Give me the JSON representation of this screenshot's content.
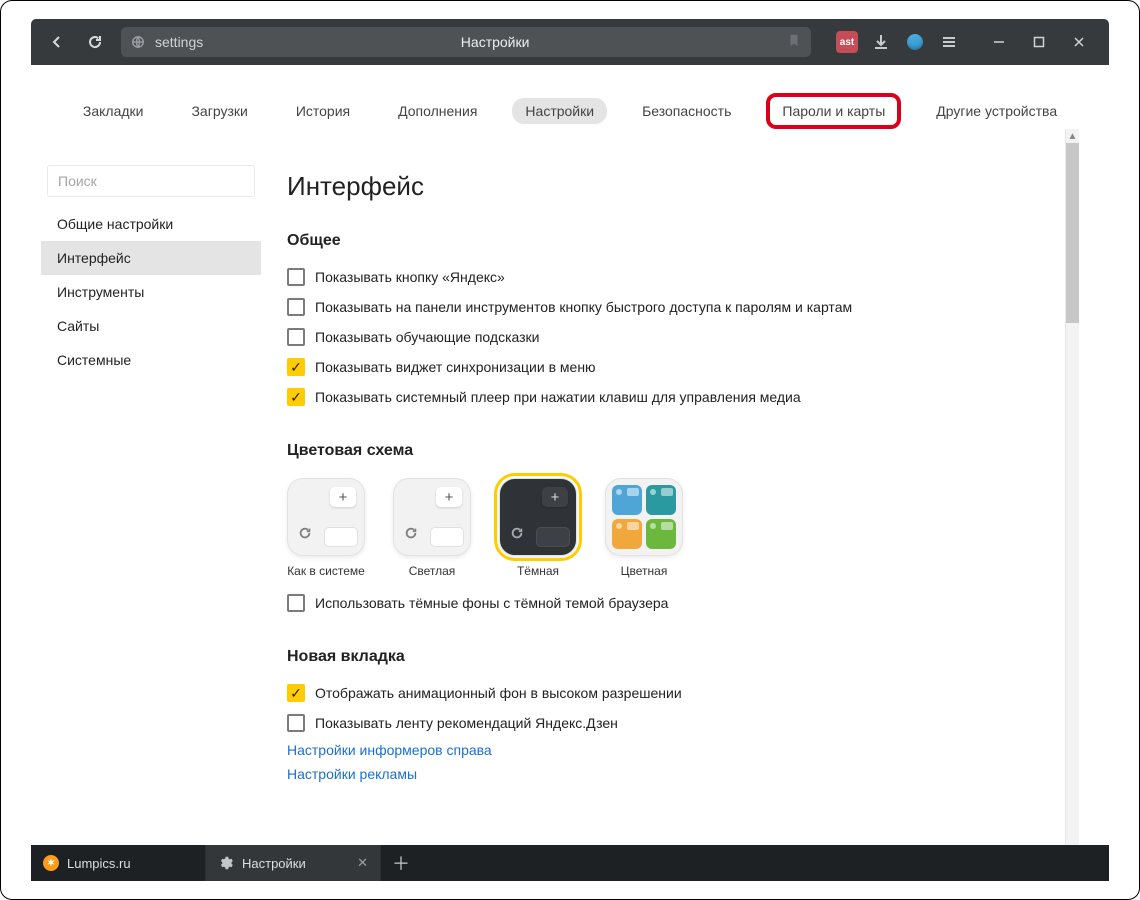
{
  "titlebar": {
    "url_site": "settings",
    "url_title": "Настройки"
  },
  "topnav": {
    "items": [
      {
        "label": "Закладки"
      },
      {
        "label": "Загрузки"
      },
      {
        "label": "История"
      },
      {
        "label": "Дополнения"
      },
      {
        "label": "Настройки",
        "active": true
      },
      {
        "label": "Безопасность"
      },
      {
        "label": "Пароли и карты",
        "highlighted": true
      },
      {
        "label": "Другие устройства"
      }
    ]
  },
  "sidebar": {
    "search_placeholder": "Поиск",
    "items": [
      {
        "label": "Общие настройки"
      },
      {
        "label": "Интерфейс",
        "active": true
      },
      {
        "label": "Инструменты"
      },
      {
        "label": "Сайты"
      },
      {
        "label": "Системные"
      }
    ]
  },
  "main": {
    "title": "Интерфейс",
    "section_general": {
      "heading": "Общее",
      "checks": [
        {
          "label": "Показывать кнопку «Яндекс»",
          "checked": false
        },
        {
          "label": "Показывать на панели инструментов кнопку быстрого доступа к паролям и картам",
          "checked": false
        },
        {
          "label": "Показывать обучающие подсказки",
          "checked": false
        },
        {
          "label": "Показывать виджет синхронизации в меню",
          "checked": true
        },
        {
          "label": "Показывать системный плеер при нажатии клавиш для управления медиа",
          "checked": true
        }
      ]
    },
    "section_theme": {
      "heading": "Цветовая схема",
      "themes": [
        {
          "label": "Как в системе"
        },
        {
          "label": "Светлая"
        },
        {
          "label": "Тёмная",
          "selected": true
        },
        {
          "label": "Цветная"
        }
      ],
      "dark_bg": {
        "label": "Использовать тёмные фоны с тёмной темой браузера",
        "checked": false
      }
    },
    "section_newtab": {
      "heading": "Новая вкладка",
      "checks": [
        {
          "label": "Отображать анимационный фон в высоком разрешении",
          "checked": true
        },
        {
          "label": "Показывать ленту рекомендаций Яндекс.Дзен",
          "checked": false
        }
      ],
      "links": [
        "Настройки информеров справа",
        "Настройки рекламы"
      ]
    }
  },
  "taskbar": {
    "tabs": [
      {
        "label": "Lumpics.ru",
        "icon": "orange"
      },
      {
        "label": "Настройки",
        "icon": "gear",
        "active": true
      }
    ]
  }
}
